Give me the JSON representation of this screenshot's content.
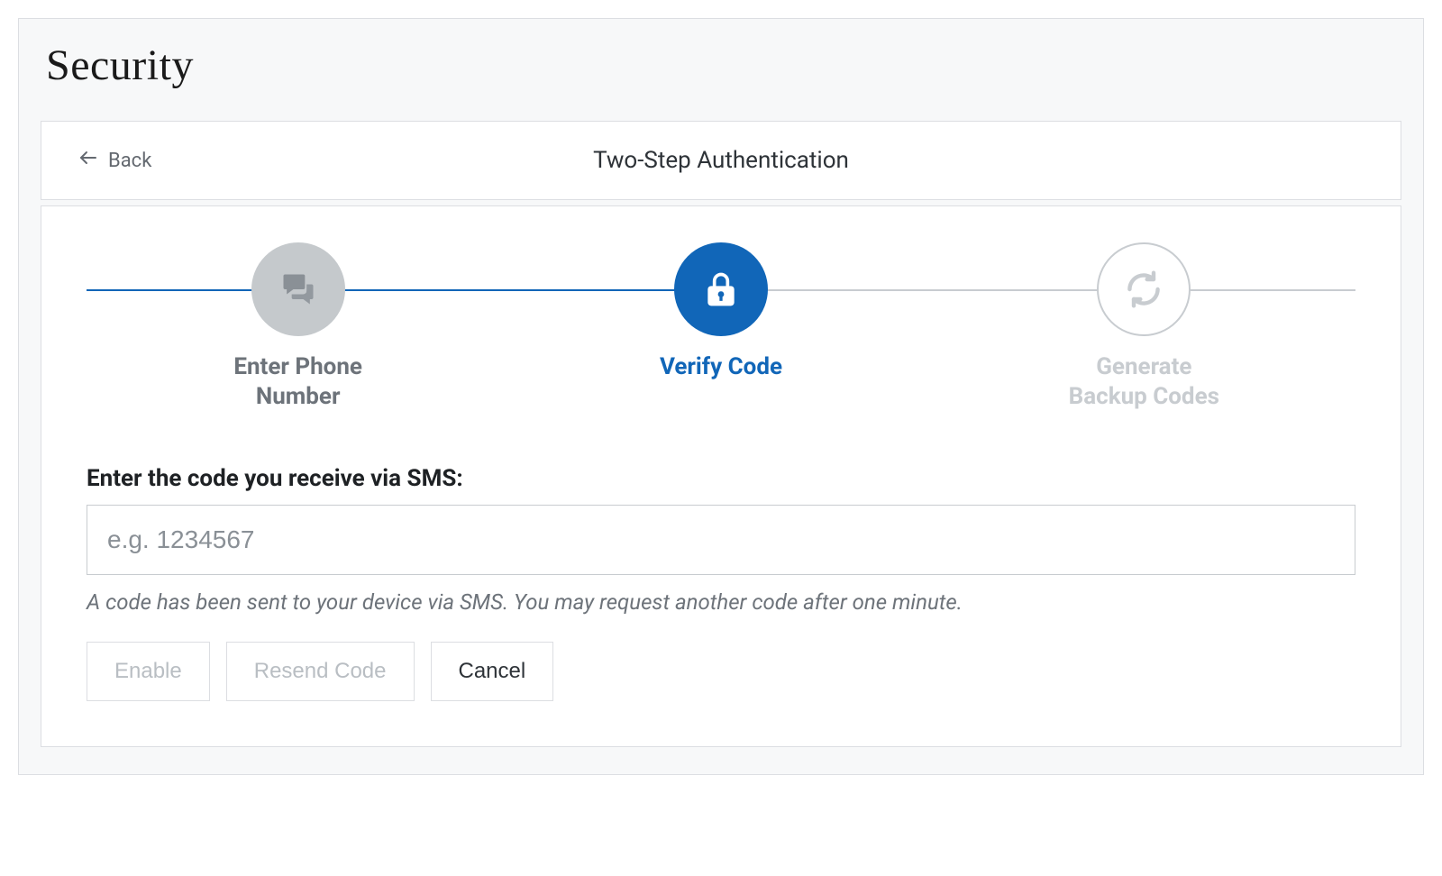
{
  "page": {
    "title": "Security"
  },
  "header": {
    "back_label": "Back",
    "title": "Two-Step Authentication"
  },
  "steps": [
    {
      "label": "Enter Phone\nNumber",
      "state": "completed",
      "icon": "chat-icon"
    },
    {
      "label": "Verify Code",
      "state": "active",
      "icon": "lock-icon"
    },
    {
      "label": "Generate\nBackup Codes",
      "state": "upcoming",
      "icon": "refresh-icon"
    }
  ],
  "form": {
    "label": "Enter the code you receive via SMS:",
    "placeholder": "e.g. 1234567",
    "value": "",
    "hint": "A code has been sent to your device via SMS. You may request another code after one minute."
  },
  "actions": {
    "enable": "Enable",
    "resend": "Resend Code",
    "cancel": "Cancel"
  }
}
